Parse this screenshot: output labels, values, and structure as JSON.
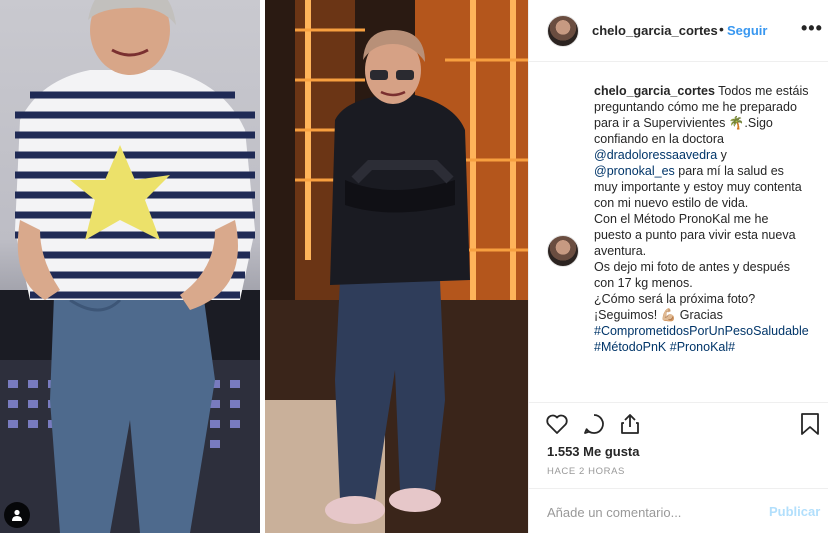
{
  "post": {
    "username": "chelo_garcia_cortes",
    "separator": "•",
    "follow_label": "Seguir",
    "more_label": "•••"
  },
  "caption": {
    "username": "chelo_garcia_cortes",
    "text_1": "Todos me estáis preguntando cómo me he preparado para ir a Supervivientes",
    "emoji_palm": "🌴",
    "text_2": ".Sigo",
    "text_3": "confiando en la doctora",
    "mention_1": "@dradoloressaavedra",
    "text_4": "y",
    "mention_2": "@pronokal_es",
    "text_5": "para mí la salud es muy importante y estoy muy contenta con mi nuevo estilo de vida.",
    "text_6": "Con el Método PronoKal me he puesto a punto para vivir esta nueva aventura.",
    "text_7": "Os dejo mi foto de antes y después con 17 kg menos.",
    "text_8": "¿Cómo será la próxima foto?",
    "text_9": "¡Seguimos!",
    "emoji_muscle": "💪🏼",
    "text_10": "Gracias",
    "hashtag_1": "#ComprometidosPorUnPesoSaludable",
    "hashtag_2": "#MétodoPnK",
    "hashtag_3": "#PronoKal#"
  },
  "stats": {
    "likes": "1.553 Me gusta",
    "time": "HACE 2 HORAS"
  },
  "comment_box": {
    "placeholder": "Añade un comentario...",
    "publish_label": "Publicar"
  },
  "icons": {
    "like": "heart-icon",
    "comment": "comment-bubble-icon",
    "share": "share-icon",
    "save": "bookmark-icon",
    "user_tag": "person-icon",
    "more": "ellipsis-icon"
  },
  "colors": {
    "link_blue": "#3897f0",
    "hashtag": "#003569",
    "publish_disabled": "#b2dffc",
    "muted": "#999999",
    "text": "#262626"
  }
}
